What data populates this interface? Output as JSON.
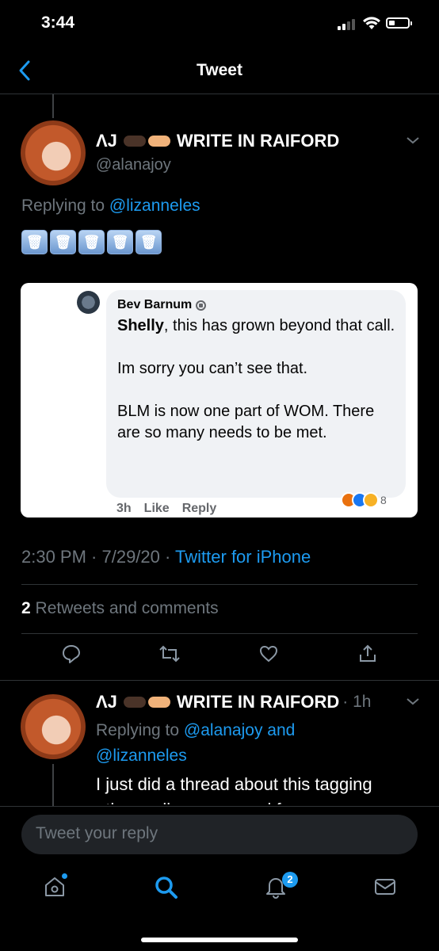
{
  "status_bar": {
    "time": "3:44"
  },
  "nav": {
    "title": "Tweet"
  },
  "tweet": {
    "display_name": "ΛJ",
    "display_name_suffix": "WRITE IN RAIFORD",
    "handle": "@alanajoy",
    "replying_prefix": "Replying to ",
    "replying_to": "@lizanneles",
    "emoji_boxes": [
      "🗑",
      "🗑",
      "🗑",
      "🗑",
      "🗑"
    ],
    "timestamp": "2:30 PM · 7/29/20 · ",
    "source": "Twitter for iPhone",
    "retweet_count": "2",
    "retweet_label": " Retweets and comments"
  },
  "embedded_comment": {
    "author": "Bev Barnum",
    "mention": "Shelly",
    "line1_rest": ", this has grown beyond that call.",
    "para2": "Im sorry you can’t see that.",
    "para3": "BLM is now one part of WOM. There are so many needs to be met.",
    "age": "3h",
    "like": "Like",
    "reply": "Reply",
    "reaction_count": "8"
  },
  "reply_tweet": {
    "display_name": "ΛJ",
    "display_name_suffix": "WRITE IN RAIFORD",
    "time": "· 1h",
    "replying_prefix": "Replying to ",
    "replying_to_1": "@alanajoy",
    "replying_and": " and",
    "replying_to_2": "@lizanneles",
    "text": "I just did a thread about this tagging",
    "text_cut": "other wells groups and for some"
  },
  "compose": {
    "placeholder": "Tweet your reply"
  },
  "tab_bar": {
    "notifications_badge": "2"
  },
  "colors": {
    "accent": "#1d9bf0",
    "background": "#000000"
  }
}
